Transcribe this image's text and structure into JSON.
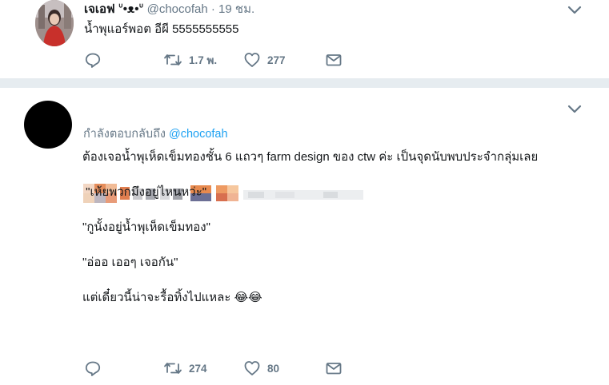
{
  "tweet1": {
    "display_name": "เจเอฟ ᐡ•ᴥ•ᐡ",
    "handle": "@chocofah",
    "separator": "·",
    "time": "19 ชม.",
    "text": "น้ำพุแอร์พอต อีผี 5555555555",
    "reply_count": "",
    "retweet_count": "1.7 พ.",
    "like_count": "277",
    "icons": [
      "reply-icon",
      "retweet-icon",
      "heart-icon",
      "message-icon",
      "chevron-down-icon"
    ]
  },
  "tweet2": {
    "reply_prefix": "กำลังตอบกลับถึง",
    "reply_mention": "@chocofah",
    "text": "ต้องเจอน้ำพุเห็ดเข็มทองชั้น 6 แถวๆ farm design ของ ctw ค่ะ เป็นจุดนับพบประจำกลุ่มเลย\n\n \"เห้ยพวกมึงอยู่ไหนหว่ะ\"\n\n\"กูนั้งอยู่น้ำพุเห็ดเข็มทอง\"\n\n\"อ่ออ เออๆ เจอกัน\"\n\nแต่เดี๋ยวนี้น่าจะรื้อทิ้งไปแหละ 😂😂",
    "reply_count": "",
    "retweet_count": "274",
    "like_count": "80",
    "icons": [
      "reply-icon",
      "retweet-icon",
      "heart-icon",
      "message-icon",
      "chevron-down-icon"
    ]
  },
  "colors": {
    "text": "#14171a",
    "muted": "#657786",
    "link": "#1da1f2",
    "divider": "#e6ecf0"
  }
}
